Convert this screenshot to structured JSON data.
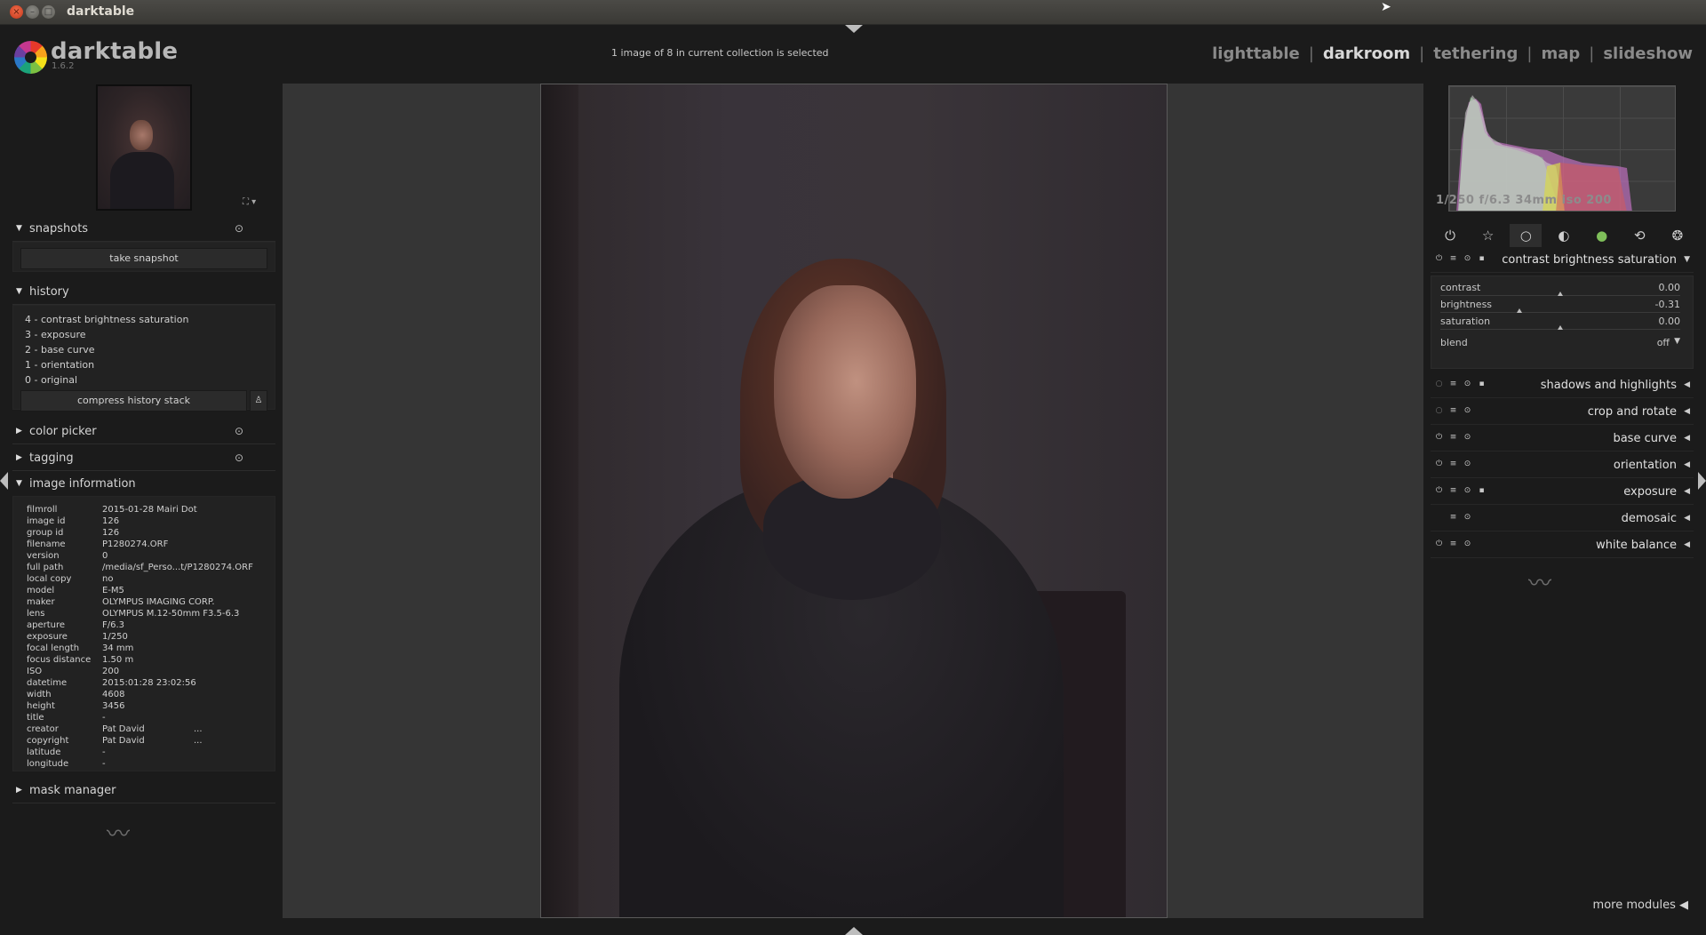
{
  "window": {
    "title": "darktable"
  },
  "header": {
    "app_name": "darktable",
    "version": "1.6.2",
    "collection_info": "1 image of 8 in current collection is selected",
    "views": [
      {
        "label": "lighttable",
        "active": false
      },
      {
        "label": "darkroom",
        "active": true
      },
      {
        "label": "tethering",
        "active": false
      },
      {
        "label": "map",
        "active": false
      },
      {
        "label": "slideshow",
        "active": false
      }
    ],
    "separator": "|"
  },
  "left": {
    "snapshots": {
      "title": "snapshots",
      "take_snapshot": "take snapshot"
    },
    "history": {
      "title": "history",
      "items": [
        "4 - contrast brightness saturation",
        "3 - exposure",
        "2 - base curve",
        "1 - orientation",
        "0 - original"
      ],
      "compress": "compress history stack"
    },
    "color_picker": {
      "title": "color picker"
    },
    "tagging": {
      "title": "tagging"
    },
    "image_information": {
      "title": "image information",
      "rows": [
        {
          "k": "filmroll",
          "v": "2015-01-28 Mairi Dot"
        },
        {
          "k": "image id",
          "v": "126"
        },
        {
          "k": "group id",
          "v": "126"
        },
        {
          "k": "filename",
          "v": "P1280274.ORF"
        },
        {
          "k": "version",
          "v": "0"
        },
        {
          "k": "full path",
          "v": "/media/sf_Perso...t/P1280274.ORF"
        },
        {
          "k": "local copy",
          "v": "no"
        },
        {
          "k": "model",
          "v": "E-M5"
        },
        {
          "k": "maker",
          "v": "OLYMPUS IMAGING CORP."
        },
        {
          "k": "lens",
          "v": "OLYMPUS M.12-50mm F3.5-6.3"
        },
        {
          "k": "aperture",
          "v": "F/6.3"
        },
        {
          "k": "exposure",
          "v": "1/250"
        },
        {
          "k": "focal length",
          "v": "34 mm"
        },
        {
          "k": "focus distance",
          "v": "1.50 m"
        },
        {
          "k": "ISO",
          "v": "200"
        },
        {
          "k": "datetime",
          "v": "2015:01:28 23:02:56"
        },
        {
          "k": "width",
          "v": "4608"
        },
        {
          "k": "height",
          "v": "3456"
        },
        {
          "k": "title",
          "v": "-"
        },
        {
          "k": "creator",
          "v": "Pat David",
          "extra": "..."
        },
        {
          "k": "copyright",
          "v": "Pat David",
          "extra": "..."
        },
        {
          "k": "latitude",
          "v": "-"
        },
        {
          "k": "longitude",
          "v": "-"
        }
      ]
    },
    "mask_manager": {
      "title": "mask manager"
    }
  },
  "right": {
    "exif_line": "1/250 f/6.3 34mm iso 200",
    "groups": [
      "power-icon",
      "star-icon",
      "circle-icon",
      "half-circle-icon",
      "color-icon",
      "rotate-icon",
      "aperture-icon"
    ],
    "active_group": 2,
    "csb": {
      "name": "contrast brightness saturation",
      "sliders": [
        {
          "label": "contrast",
          "value": "0.00",
          "position": 0.5
        },
        {
          "label": "brightness",
          "value": "-0.31",
          "position": 0.33
        },
        {
          "label": "saturation",
          "value": "0.00",
          "position": 0.5
        }
      ],
      "blend_label": "blend",
      "blend_value": "off"
    },
    "modules": [
      {
        "name": "shadows and highlights",
        "enabled": false,
        "presets": true
      },
      {
        "name": "crop and rotate",
        "enabled": false,
        "presets": false
      },
      {
        "name": "base curve",
        "enabled": true,
        "presets": false
      },
      {
        "name": "orientation",
        "enabled": true,
        "presets": false
      },
      {
        "name": "exposure",
        "enabled": true,
        "presets": true
      },
      {
        "name": "demosaic",
        "enabled": null,
        "presets": false
      },
      {
        "name": "white balance",
        "enabled": true,
        "presets": false
      }
    ],
    "more_modules": "more modules"
  },
  "colors": {
    "background": "#1b1b1b",
    "center": "#353535",
    "accent_text": "#d8d8d8"
  }
}
